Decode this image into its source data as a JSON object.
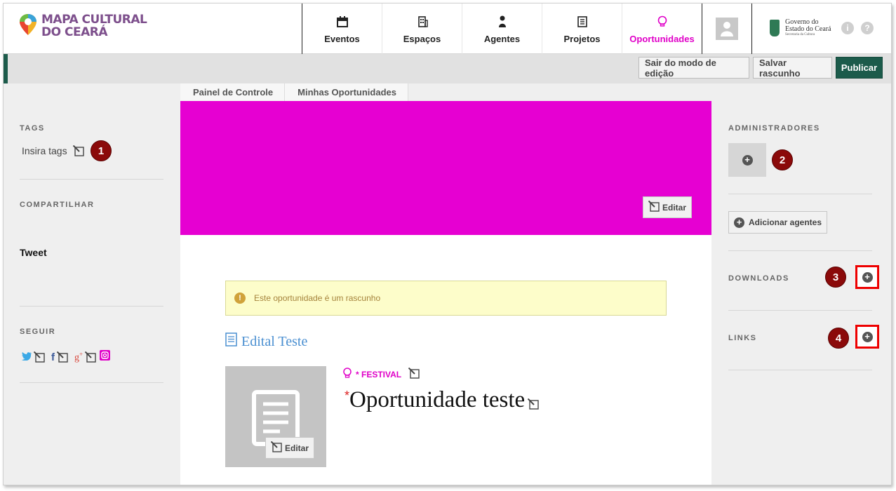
{
  "header": {
    "logo_line1": "MAPA CULTURAL",
    "logo_line2": "DO CEARÁ",
    "nav": [
      {
        "label": "Eventos",
        "icon": "calendar-icon"
      },
      {
        "label": "Espaços",
        "icon": "building-icon"
      },
      {
        "label": "Agentes",
        "icon": "person-icon"
      },
      {
        "label": "Projetos",
        "icon": "document-icon"
      },
      {
        "label": "Oportunidades",
        "icon": "lightbulb-icon",
        "active": true
      }
    ],
    "gov_line1": "Governo do",
    "gov_line2": "Estado do Ceará",
    "gov_line3": "Secretaria da Cultura"
  },
  "editbar": {
    "exit_label": "Sair do modo de edição",
    "save_label": "Salvar rascunho",
    "publish_label": "Publicar"
  },
  "left": {
    "tags_title": "TAGS",
    "tags_placeholder": "Insira tags",
    "share_title": "COMPARTILHAR",
    "tweet_label": "Tweet",
    "follow_title": "SEGUIR"
  },
  "breadcrumb": [
    "Painel de Controle",
    "Minhas Oportunidades"
  ],
  "cover": {
    "edit_label": "Editar",
    "color": "#e600d2"
  },
  "alert_text": "Este oportunidade é um rascunho",
  "edital_label": "Edital Teste",
  "opportunity": {
    "type": "* FESTIVAL",
    "title_mark": "*",
    "title": "Oportunidade teste",
    "avatar_edit_label": "Editar"
  },
  "right": {
    "admins_title": "ADMINISTRADORES",
    "add_agents_label": "Adicionar agentes",
    "downloads_title": "DOWNLOADS",
    "links_title": "LINKS"
  },
  "markers": [
    "1",
    "2",
    "3",
    "4"
  ],
  "colors": {
    "accent": "#e000c8",
    "primary": "#1c5b4b",
    "marker": "#8b0a0a"
  }
}
